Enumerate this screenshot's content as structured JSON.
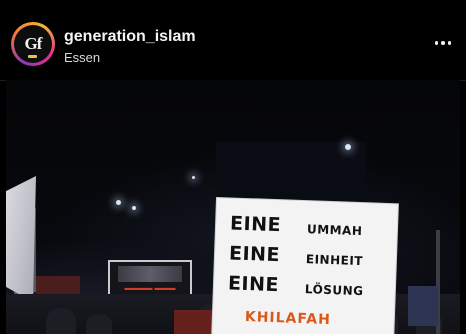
{
  "post": {
    "username": "generation_islam",
    "location": "Essen",
    "avatar_initials": "Gf",
    "more_icon": "more-horizontal-icon"
  },
  "photo": {
    "placard": {
      "rows": [
        {
          "big": "EINE",
          "small": "UMMAH"
        },
        {
          "big": "EINE",
          "small": "EINHEIT"
        },
        {
          "big": "EINE",
          "small": "LÖSUNG"
        }
      ],
      "accent": "KHILAFAH"
    }
  },
  "colors": {
    "accent_text": "#d9591c",
    "background": "#000000"
  }
}
